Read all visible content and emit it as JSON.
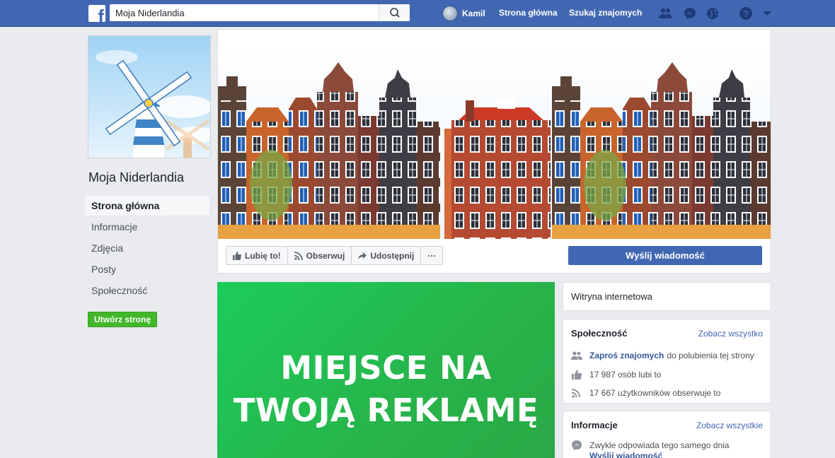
{
  "topbar": {
    "search_value": "Moja Niderlandia",
    "user_name": "Kamil",
    "home_label": "Strona główna",
    "find_friends_label": "Szukaj znajomych"
  },
  "page": {
    "name": "Moja Niderlandia"
  },
  "left_menu": {
    "items": [
      {
        "label": "Strona główna",
        "active": true
      },
      {
        "label": "Informacje"
      },
      {
        "label": "Zdjęcia"
      },
      {
        "label": "Posty"
      },
      {
        "label": "Społeczność"
      }
    ],
    "create_page_label": "Utwórz stronę"
  },
  "actions": {
    "like_label": "Lubię to!",
    "follow_label": "Obserwuj",
    "share_label": "Udostępnij",
    "more_label": "···",
    "send_message_label": "Wyślij wiadomość"
  },
  "ad": {
    "line1": "MIEJSCE NA",
    "line2": "TWOJĄ REKLAMĘ"
  },
  "website_card": {
    "label": "Witryna internetowa"
  },
  "community": {
    "title": "Społeczność",
    "see_all": "Zobacz wszystko",
    "invite_link": "Zaproś znajomych",
    "invite_rest": "do polubienia tej strony",
    "likes_text": "17 987 osób lubi to",
    "followers_text": "17 667 użytkowników obserwuje to"
  },
  "info": {
    "title": "Informacje",
    "see_all": "Zobacz wszystkie",
    "response_text": "Zwykle odpowiada tego samego dnia",
    "send_message_link": "Wyślij wiadomość"
  },
  "colors": {
    "brand": "#4267b2",
    "ad_green": "#1ccc5b",
    "create_green": "#42b72a",
    "link": "#365899"
  }
}
